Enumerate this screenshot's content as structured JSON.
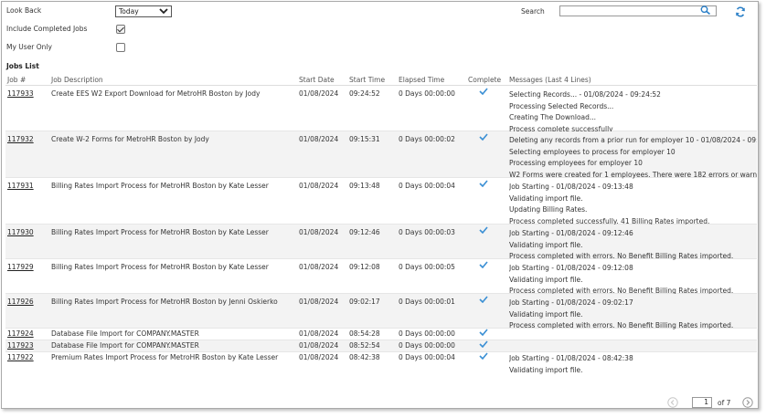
{
  "filters": {
    "look_back_label": "Look Back",
    "look_back_value": "Today",
    "include_completed_label": "Include Completed Jobs",
    "include_completed_checked": true,
    "my_user_only_label": "My User Only",
    "my_user_only_checked": false,
    "search_label": "Search",
    "search_value": ""
  },
  "jobs_list_title": "Jobs List",
  "columns": {
    "job": "Job #",
    "description": "Job Description",
    "start_date": "Start Date",
    "start_time": "Start Time",
    "elapsed": "Elapsed Time",
    "complete": "Complete",
    "messages": "Messages (Last 4 Lines)"
  },
  "jobs": [
    {
      "id": "117933",
      "description": "Create EES W2 Export Download for MetroHR Boston by Jody",
      "start_date": "01/08/2024",
      "start_time": "09:24:52",
      "elapsed": "0 Days 00:00:00",
      "complete": true,
      "messages": [
        "Selecting Records... - 01/08/2024 - 09:24:52",
        "Processing Selected Records...",
        "Creating The Download...",
        "Process complete successfully"
      ]
    },
    {
      "id": "117932",
      "description": "Create W-2 Forms for MetroHR Boston by Jody",
      "start_date": "01/08/2024",
      "start_time": "09:15:31",
      "elapsed": "0 Days 00:00:02",
      "complete": true,
      "messages": [
        "Deleting any records from a prior run for employer 10 - 01/08/2024 - 09:1",
        "Selecting employees to process for employer 10",
        "Processing employees for employer 10",
        "W2 Forms were created for 1 employees. There were 182 errors or warning"
      ]
    },
    {
      "id": "117931",
      "description": "Billing Rates Import Process for MetroHR Boston by Kate Lesser",
      "start_date": "01/08/2024",
      "start_time": "09:13:48",
      "elapsed": "0 Days 00:00:04",
      "complete": true,
      "messages": [
        "Job Starting - 01/08/2024 - 09:13:48",
        "Validating import file.",
        "Updating Billing Rates.",
        "Process completed successfully. 41 Billing Rates imported."
      ]
    },
    {
      "id": "117930",
      "description": "Billing Rates Import Process for MetroHR Boston by Kate Lesser",
      "start_date": "01/08/2024",
      "start_time": "09:12:46",
      "elapsed": "0 Days 00:00:03",
      "complete": true,
      "messages": [
        "Job Starting - 01/08/2024 - 09:12:46",
        "Validating import file.",
        "Process completed with errors. No Benefit Billing Rates imported."
      ]
    },
    {
      "id": "117929",
      "description": "Billing Rates Import Process for MetroHR Boston by Kate Lesser",
      "start_date": "01/08/2024",
      "start_time": "09:12:08",
      "elapsed": "0 Days 00:00:05",
      "complete": true,
      "messages": [
        "Job Starting - 01/08/2024 - 09:12:08",
        "Validating import file.",
        "Process completed with errors. No Benefit Billing Rates imported."
      ]
    },
    {
      "id": "117926",
      "description": "Billing Rates Import Process for MetroHR Boston by Jenni Oskierko",
      "start_date": "01/08/2024",
      "start_time": "09:02:17",
      "elapsed": "0 Days 00:00:01",
      "complete": true,
      "messages": [
        "Job Starting - 01/08/2024 - 09:02:17",
        "Validating import file.",
        "Process completed with errors. No Benefit Billing Rates imported."
      ]
    },
    {
      "id": "117924",
      "description": "Database File Import for COMPANY.MASTER",
      "start_date": "01/08/2024",
      "start_time": "08:54:28",
      "elapsed": "0 Days 00:00:00",
      "complete": true,
      "messages": []
    },
    {
      "id": "117923",
      "description": "Database File Import for COMPANY.MASTER",
      "start_date": "01/08/2024",
      "start_time": "08:52:54",
      "elapsed": "0 Days 00:00:00",
      "complete": true,
      "messages": []
    },
    {
      "id": "117922",
      "description": "Premium Rates Import Process for MetroHR Boston by Kate Lesser",
      "start_date": "01/08/2024",
      "start_time": "08:42:38",
      "elapsed": "0 Days 00:00:04",
      "complete": true,
      "messages": [
        "Job Starting - 01/08/2024 - 08:42:38",
        "Validating import file."
      ]
    }
  ],
  "pager": {
    "page": "1",
    "of_label": "of 7"
  },
  "colors": {
    "accent": "#2a7fc7",
    "check": "#3a8fd4",
    "shaded_row": "#f3f3f3"
  }
}
